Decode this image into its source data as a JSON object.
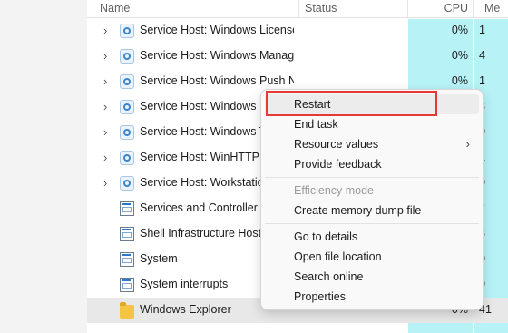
{
  "columns": {
    "name": "Name",
    "status": "Status",
    "cpu": "CPU",
    "memory": "Me"
  },
  "rows": [
    {
      "name": "Service Host: Windows License Manager Service",
      "cpu": "0%",
      "mem": "1",
      "expandable": true,
      "icon": "gear-icon"
    },
    {
      "name": "Service Host: Windows Management Instrumentation",
      "cpu": "0%",
      "mem": "4",
      "expandable": true,
      "icon": "gear-icon"
    },
    {
      "name": "Service Host: Windows Push Notifications",
      "cpu": "0%",
      "mem": "1",
      "expandable": true,
      "icon": "gear-icon"
    },
    {
      "name": "Service Host: Windows Push Notifications User Service",
      "cpu": "",
      "mem": "3",
      "expandable": true,
      "icon": "gear-icon"
    },
    {
      "name": "Service Host: Windows Time",
      "cpu": "",
      "mem": "0",
      "expandable": true,
      "icon": "gear-icon"
    },
    {
      "name": "Service Host: WinHTTP Web Proxy",
      "cpu": "",
      "mem": "1",
      "expandable": true,
      "icon": "gear-icon"
    },
    {
      "name": "Service Host: Workstation",
      "cpu": "",
      "mem": "0",
      "expandable": true,
      "icon": "gear-icon"
    },
    {
      "name": "Services and Controller app",
      "cpu": "",
      "mem": "2",
      "expandable": false,
      "icon": "window-icon"
    },
    {
      "name": "Shell Infrastructure Host",
      "cpu": "",
      "mem": "3",
      "expandable": false,
      "icon": "window-icon"
    },
    {
      "name": "System",
      "cpu": "",
      "mem": "0",
      "expandable": false,
      "icon": "window-icon"
    },
    {
      "name": "System interrupts",
      "cpu": "",
      "mem": "0",
      "expandable": false,
      "icon": "window-icon"
    },
    {
      "name": "Windows Explorer",
      "cpu": "0%",
      "mem": "41",
      "expandable": false,
      "icon": "folder-icon",
      "selected": true
    }
  ],
  "context_menu": {
    "items": [
      {
        "label": "Restart",
        "enabled": true
      },
      {
        "label": "End task",
        "enabled": true
      },
      {
        "label": "Resource values",
        "enabled": true,
        "submenu": true,
        "arrow": "›"
      },
      {
        "label": "Provide feedback",
        "enabled": true
      },
      {
        "label": "Efficiency mode",
        "enabled": false
      },
      {
        "label": "Create memory dump file",
        "enabled": true
      },
      {
        "label": "Go to details",
        "enabled": true
      },
      {
        "label": "Open file location",
        "enabled": true
      },
      {
        "label": "Search online",
        "enabled": true
      },
      {
        "label": "Properties",
        "enabled": true
      }
    ]
  },
  "accent": {
    "cpu_heat": "#b7f2f7",
    "highlight_box": "#e53935"
  },
  "chevron": "›"
}
